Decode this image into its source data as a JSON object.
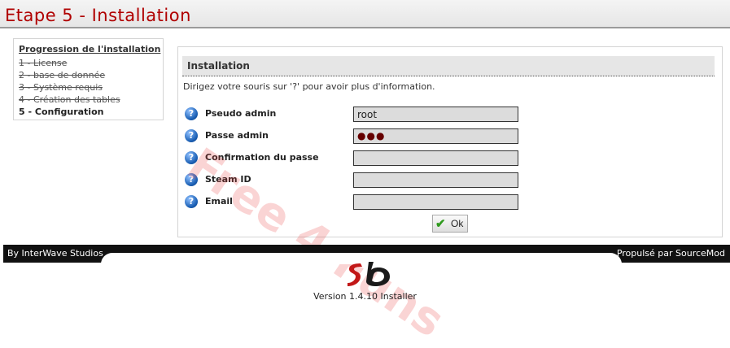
{
  "title": "Etape 5 - Installation",
  "progress": {
    "title": "Progression de l'installation",
    "steps": [
      {
        "label": "1 - License",
        "state": "done"
      },
      {
        "label": "2 - base de donnée",
        "state": "done"
      },
      {
        "label": "3 - Système requis",
        "state": "done"
      },
      {
        "label": "4 - Création des tables",
        "state": "done"
      },
      {
        "label": "5 - Configuration",
        "state": "current"
      }
    ]
  },
  "panel": {
    "heading": "Installation",
    "hint": "Dirigez votre souris sur '?' pour avoir plus d'information.",
    "help_icon": "question-mark",
    "fields": [
      {
        "label": "Pseudo admin",
        "value": "root",
        "type": "text"
      },
      {
        "label": "Passe admin",
        "value": "●●●",
        "type": "password"
      },
      {
        "label": "Confirmation du passe",
        "value": "",
        "type": "password"
      },
      {
        "label": "Steam ID",
        "value": "",
        "type": "text"
      },
      {
        "label": "Email",
        "value": "",
        "type": "text"
      }
    ],
    "ok_label": "Ok"
  },
  "watermark": "Free 4 Funs",
  "footer": {
    "left": "By InterWave Studios",
    "right": "Propulsé par SourceMod",
    "version": "Version 1.4.10 Installer"
  },
  "colors": {
    "title": "#b00000",
    "footer_bg": "#111111",
    "input_bg": "#dcdcdc",
    "ok_check": "#2f9a1d"
  }
}
